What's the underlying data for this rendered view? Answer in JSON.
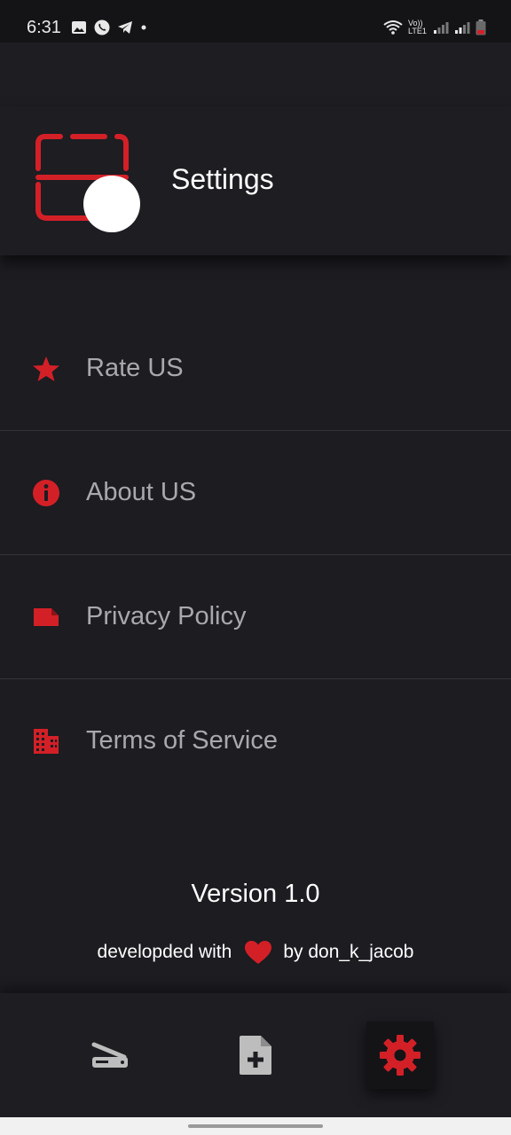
{
  "status_bar": {
    "time": "6:31",
    "network_label": "Vo)) LTE1"
  },
  "header": {
    "title": "Settings",
    "logo_icon": "scanner-logo-icon"
  },
  "menu": {
    "items": [
      {
        "label": "Rate US",
        "icon": "star-icon"
      },
      {
        "label": "About US",
        "icon": "info-icon"
      },
      {
        "label": "Privacy Policy",
        "icon": "tag-icon"
      },
      {
        "label": "Terms of Service",
        "icon": "building-icon"
      }
    ]
  },
  "footer": {
    "version": "Version 1.0",
    "dev_prefix": "developded with",
    "dev_suffix": "by don_k_jacob"
  },
  "bottom_nav": {
    "items": [
      {
        "name": "scanner-icon",
        "active": false
      },
      {
        "name": "add-document-icon",
        "active": false
      },
      {
        "name": "settings-icon",
        "active": true
      }
    ]
  },
  "colors": {
    "accent": "#d32027",
    "background": "#1c1c21",
    "muted_text": "#a9a9ad"
  }
}
